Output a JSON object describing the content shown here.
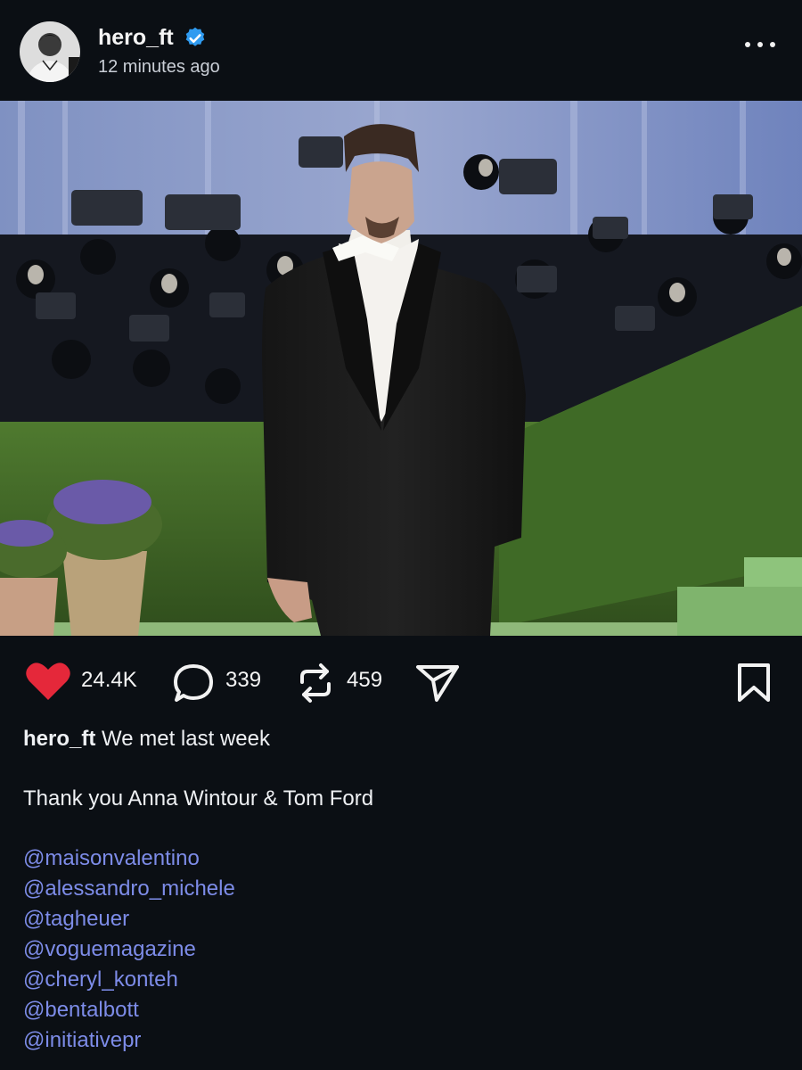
{
  "post": {
    "username": "hero_ft",
    "timestamp": "12 minutes ago",
    "verified": true,
    "more_icon": "more-horizontal-icon"
  },
  "stats": {
    "likes": "24.4K",
    "comments": "339",
    "reposts": "459",
    "liked": true,
    "like_color": "#e5283a"
  },
  "caption": {
    "username": "hero_ft",
    "line1": "We met last week",
    "line2": "Thank you Anna Wintour & Tom Ford",
    "mentions": [
      "@maisonvalentino",
      "@alessandro_michele",
      "@tagheuer",
      "@voguemagazine",
      "@cheryl_konteh",
      "@bentalbott",
      "@initiativepr"
    ]
  },
  "colors": {
    "background": "#0b0f14",
    "mention": "#7d8ce8",
    "verified": "#2f9bf0"
  }
}
